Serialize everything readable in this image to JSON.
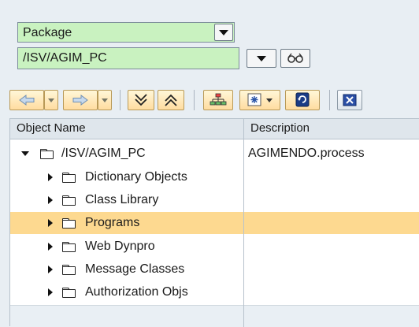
{
  "selector": {
    "type_value": "Package",
    "path_value": "/ISV/AGIM_PC"
  },
  "toolbar": {
    "buttons": [
      "back-icon",
      "forward-icon",
      "expand-icon",
      "collapse-icon",
      "hierarchy-icon",
      "settings-icon",
      "refresh-icon",
      "close-icon"
    ]
  },
  "tree": {
    "columns": {
      "name": "Object Name",
      "description": "Description"
    },
    "root": {
      "name": "/ISV/AGIM_PC",
      "description": "AGIMENDO.process"
    },
    "children": [
      {
        "name": "Dictionary Objects"
      },
      {
        "name": "Class Library"
      },
      {
        "name": "Programs"
      },
      {
        "name": "Web Dynpro"
      },
      {
        "name": "Message Classes"
      },
      {
        "name": "Authorization Objs"
      }
    ],
    "selected_index": 2
  },
  "colors": {
    "field_bg": "#c9f2c0",
    "selected_row": "#fdd990",
    "header_bg": "#dfe6ec"
  }
}
